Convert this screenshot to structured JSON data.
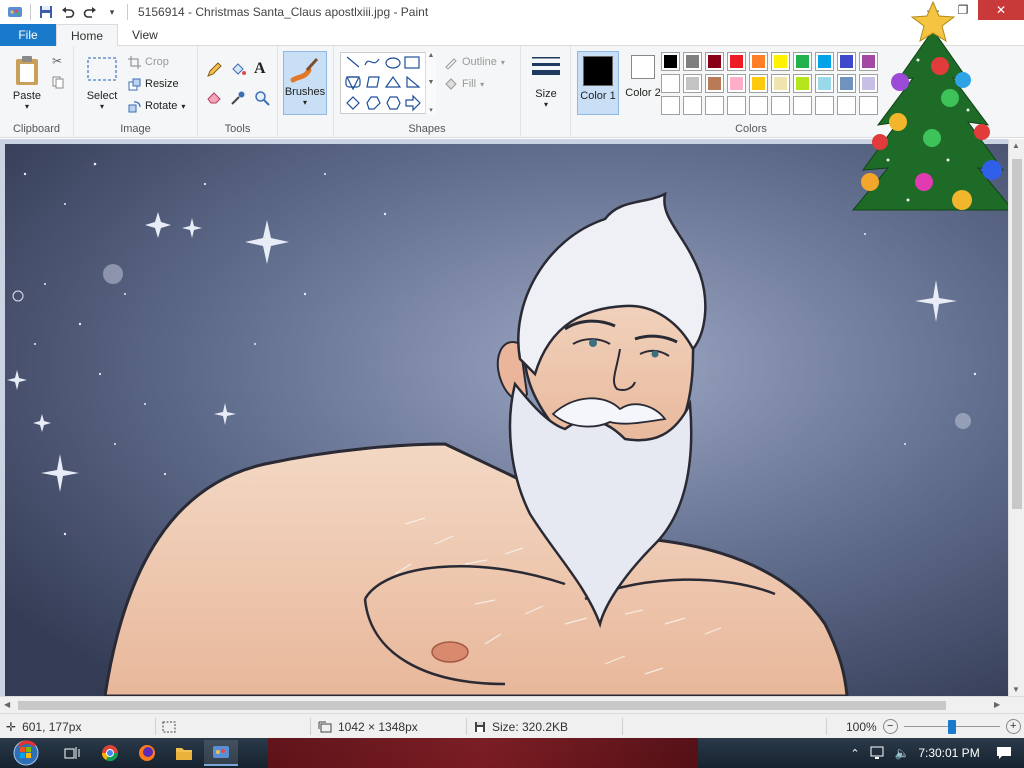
{
  "window": {
    "title": "5156914 - Christmas Santa_Claus apostlxiii.jpg - Paint",
    "minimize_glyph": "—",
    "maximize_glyph": "❐",
    "close_glyph": "✕"
  },
  "tabs": [
    {
      "label": "File"
    },
    {
      "label": "Home"
    },
    {
      "label": "View"
    }
  ],
  "ribbon": {
    "clipboard": {
      "label": "Clipboard",
      "paste": "Paste"
    },
    "image": {
      "label": "Image",
      "select": "Select",
      "crop": "Crop",
      "resize": "Resize",
      "rotate": "Rotate"
    },
    "tools": {
      "label": "Tools"
    },
    "brushes": {
      "label": "Brushes"
    },
    "shapes": {
      "label": "Shapes",
      "outline": "Outline",
      "fill": "Fill"
    },
    "size": {
      "label": "Size"
    },
    "colors": {
      "label": "Colors",
      "color1": "Color 1",
      "color2": "Color 2",
      "color1_value": "#000000",
      "color2_value": "#ffffff",
      "palette_row1": [
        "#000000",
        "#7f7f7f",
        "#880015",
        "#ed1c24",
        "#ff7f27",
        "#fff200",
        "#22b14c",
        "#00a2e8",
        "#3f48cc",
        "#a349a4"
      ],
      "palette_row2": [
        "#ffffff",
        "#c3c3c3",
        "#b97a57",
        "#ffaec9",
        "#ffc90e",
        "#efe4b0",
        "#b5e61d",
        "#99d9ea",
        "#7092be",
        "#c8bfe7"
      ],
      "palette_row3": [
        "#ffffff",
        "#ffffff",
        "#ffffff",
        "#ffffff",
        "#ffffff",
        "#ffffff",
        "#ffffff",
        "#ffffff",
        "#ffffff",
        "#ffffff"
      ]
    }
  },
  "status": {
    "cursor_pos": "601, 177px",
    "dimensions": "1042 × 1348px",
    "size": "Size: 320.2KB",
    "zoom": "100%"
  },
  "taskbar": {
    "time": "7:30:01 PM"
  },
  "scroll": {
    "up": "▲",
    "down": "▼",
    "left": "◀",
    "right": "▶"
  }
}
